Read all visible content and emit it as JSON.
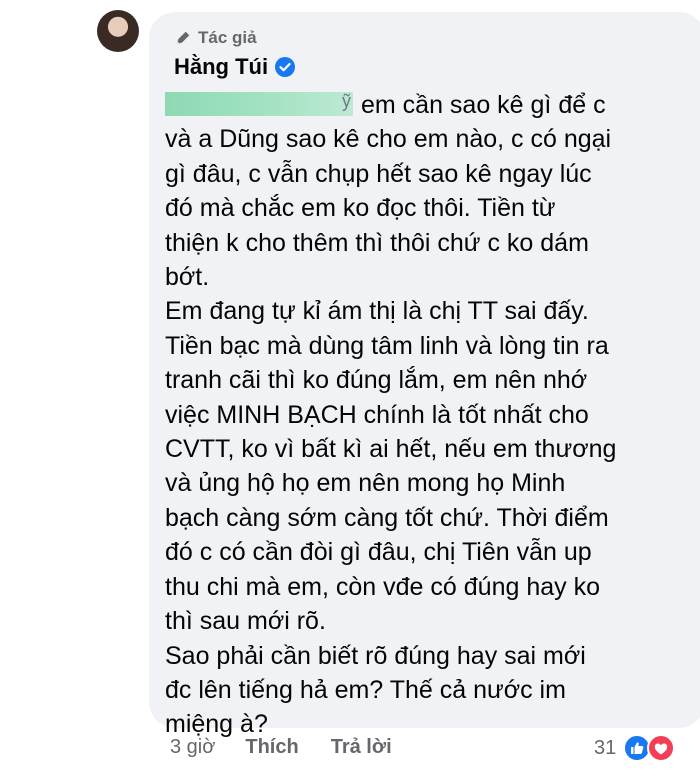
{
  "comment": {
    "badge": "Tác giả",
    "author": "Hằng Túi",
    "lines": [
      "em cần sao kê gì để c",
      "và a Dũng sao kê cho em nào, c có ngại",
      "gì đâu, c vẫn chụp hết sao kê ngay lúc",
      "đó mà chắc em ko đọc thôi. Tiền từ",
      "thiện k cho thêm thì thôi chứ c ko dám",
      "bớt.",
      "Em đang tự kỉ ám thị là chị TT sai đấy.",
      "Tiền bạc mà dùng tâm linh và lòng tin ra",
      "tranh cãi thì ko đúng lắm, em nên nhớ",
      "việc MINH BẠCH chính là tốt nhất cho",
      "CVTT, ko vì bất kì ai hết, nếu em thương",
      "và ủng hộ họ em nên mong họ Minh",
      "bạch càng sớm càng tốt chứ. Thời điểm",
      "đó c có cần đòi gì đâu, chị Tiên vẫn up",
      "thu chi mà em, còn vđe có đúng hay ko",
      "thì sau mới rõ.",
      "Sao phải cần biết rõ đúng hay sai mới",
      "đc lên tiếng hả em? Thế cả nước im",
      "miệng à?"
    ],
    "mention_tail": "ỹ"
  },
  "actions": {
    "time": "3 giờ",
    "like": "Thích",
    "reply": "Trả lời"
  },
  "reactions": {
    "count": "31",
    "icons": [
      "like-icon",
      "love-icon"
    ]
  },
  "colors": {
    "bubble": "#f0f2f5",
    "secondary_text": "#65676b",
    "like_blue": "#1877f2",
    "love_red": "#f33e58"
  }
}
